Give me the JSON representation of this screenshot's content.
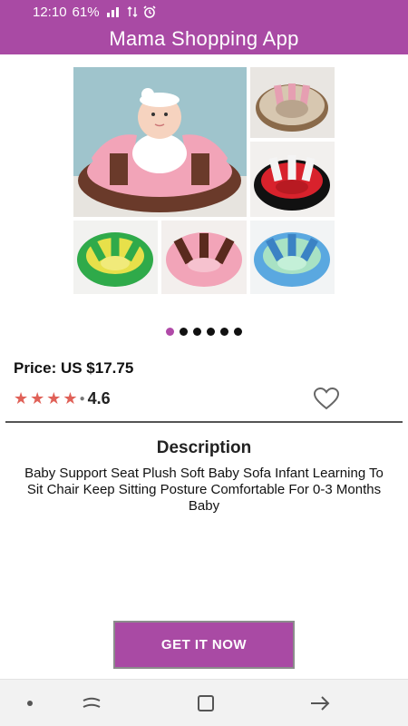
{
  "status_bar": {
    "time": "12:10",
    "battery": "61%",
    "icons": [
      "signal-icon",
      "data-icon",
      "alarm-icon"
    ]
  },
  "app_bar": {
    "title": "Mama Shopping App"
  },
  "product": {
    "image": "baby-seat-collage",
    "carousel_count": 6,
    "carousel_active": 0,
    "price_text": "Price: US $17.75",
    "rating_stars": 4,
    "rating_value": "4.6",
    "favorite_icon": "heart-outline-icon"
  },
  "description": {
    "title": "Description",
    "text": "Baby Support Seat Plush Soft Baby Sofa Infant Learning To Sit Chair Keep Sitting Posture Comfortable For 0-3 Months Baby"
  },
  "cta": {
    "label": "GET IT NOW"
  },
  "nav_bar": {
    "buttons": [
      "dot-icon",
      "recent-apps-icon",
      "home-icon",
      "back-icon"
    ]
  },
  "colors": {
    "brand": "#a94aa4",
    "active_dot": "#b04aa8",
    "star": "#e06158"
  }
}
